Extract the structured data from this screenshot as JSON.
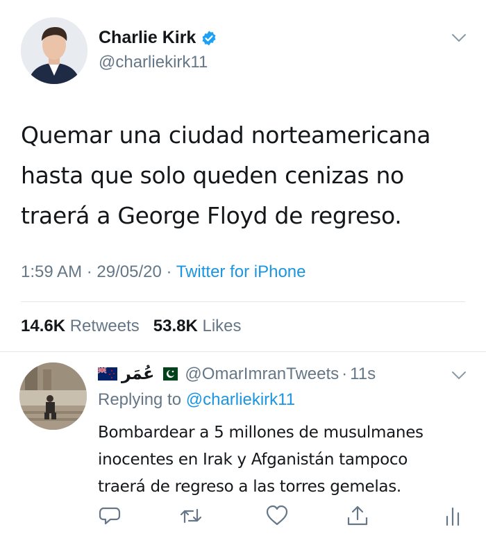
{
  "tweet": {
    "display_name": "Charlie Kirk",
    "handle": "@charliekirk11",
    "text": "Quemar una ciudad norteamericana\nhasta que solo queden cenizas no\ntraerá a George Floyd de regreso.",
    "time": "1:59 AM",
    "date": "29/05/20",
    "separator": "·",
    "source": "Twitter for iPhone",
    "retweets_count": "14.6K",
    "retweets_label": "Retweets",
    "likes_count": "53.8K",
    "likes_label": "Likes"
  },
  "reply": {
    "name_arabic": "عُمَر",
    "handle": "@OmarImranTweets",
    "elapsed": "11s",
    "replying_label": "Replying to",
    "replying_handle": "@charliekirk11",
    "text": "Bombardear a 5 millones de musulmanes\ninocentes en Irak y Afganistán tampoco\ntraerá de regreso a las torres gemelas."
  },
  "icons": {
    "verified": "verified-badge-icon",
    "chevron": "chevron-down-icon",
    "reply": "reply-icon",
    "retweet": "retweet-icon",
    "like": "like-icon",
    "share": "share-icon",
    "analytics": "analytics-icon"
  },
  "colors": {
    "text": "#14171a",
    "secondary": "#657786",
    "link": "#1b95e0",
    "divider": "#e1e8ed"
  }
}
